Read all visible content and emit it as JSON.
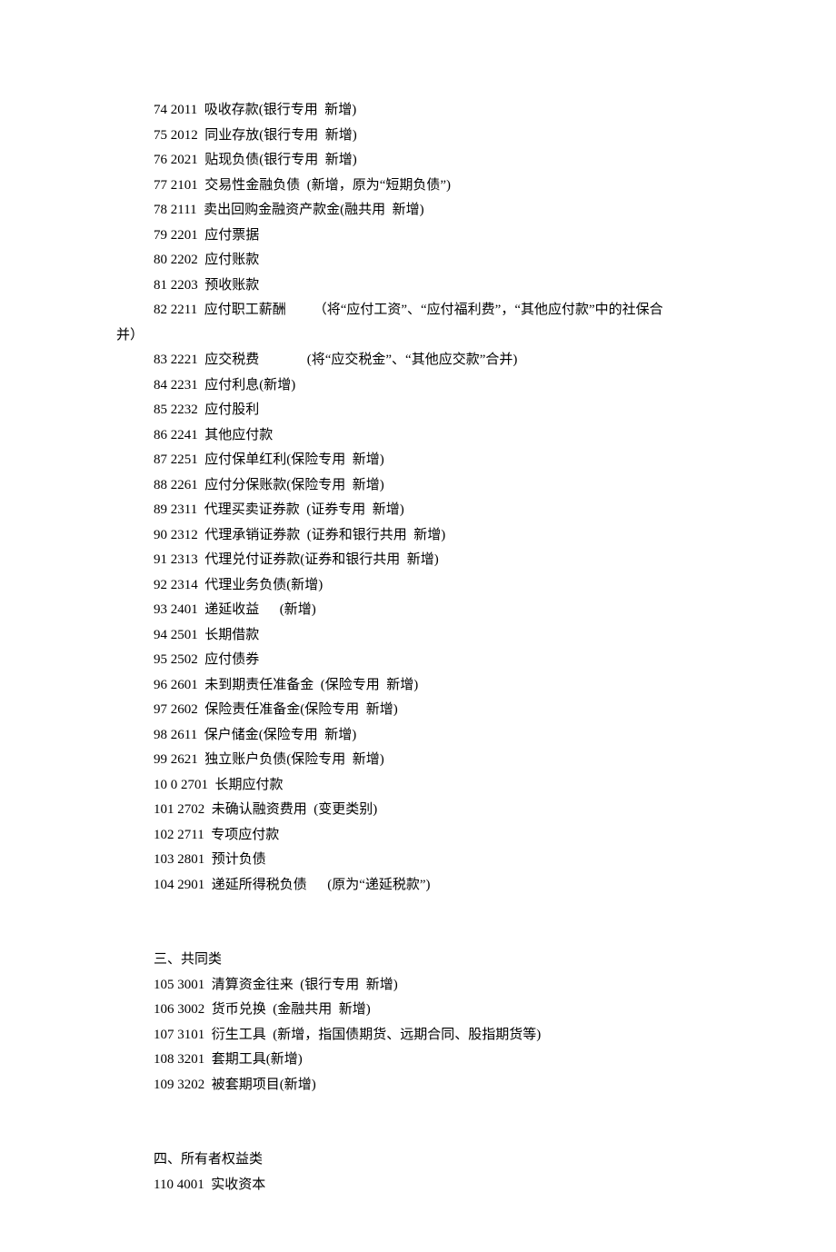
{
  "lines": [
    {
      "cls": "indent",
      "text": "74 2011  吸收存款(银行专用  新增)"
    },
    {
      "cls": "indent",
      "text": "75 2012  同业存放(银行专用  新增)"
    },
    {
      "cls": "indent",
      "text": "76 2021  贴现负债(银行专用  新增)"
    },
    {
      "cls": "indent",
      "text": "77 2101  交易性金融负债  (新增，原为“短期负债”)"
    },
    {
      "cls": "indent",
      "text": "78 2111  卖出回购金融资产款金(融共用  新增)"
    },
    {
      "cls": "indent",
      "text": "79 2201  应付票据"
    },
    {
      "cls": "indent",
      "text": "80 2202  应付账款"
    },
    {
      "cls": "indent",
      "text": "81 2203  预收账款"
    },
    {
      "cls": "indent",
      "text": "82 2211  应付职工薪酬        （将“应付工资”、“应付福利费”，“其他应付款”中的社保合"
    },
    {
      "cls": "no-indent",
      "text": "并）"
    },
    {
      "cls": "indent",
      "text": "83 2221  应交税费              (将“应交税金”、“其他应交款”合并)"
    },
    {
      "cls": "indent",
      "text": "84 2231  应付利息(新增)"
    },
    {
      "cls": "indent",
      "text": "85 2232  应付股利"
    },
    {
      "cls": "indent",
      "text": "86 2241  其他应付款"
    },
    {
      "cls": "indent",
      "text": "87 2251  应付保单红利(保险专用  新增)"
    },
    {
      "cls": "indent",
      "text": "88 2261  应付分保账款(保险专用  新增)"
    },
    {
      "cls": "indent",
      "text": "89 2311  代理买卖证券款  (证券专用  新增)"
    },
    {
      "cls": "indent",
      "text": "90 2312  代理承销证券款  (证券和银行共用  新增)"
    },
    {
      "cls": "indent",
      "text": "91 2313  代理兑付证券款(证券和银行共用  新增)"
    },
    {
      "cls": "indent",
      "text": "92 2314  代理业务负债(新增)"
    },
    {
      "cls": "indent",
      "text": "93 2401  递延收益      (新增)"
    },
    {
      "cls": "indent",
      "text": "94 2501  长期借款"
    },
    {
      "cls": "indent",
      "text": "95 2502  应付债券"
    },
    {
      "cls": "indent",
      "text": "96 2601  未到期责任准备金  (保险专用  新增)"
    },
    {
      "cls": "indent",
      "text": "97 2602  保险责任准备金(保险专用  新增)"
    },
    {
      "cls": "indent",
      "text": "98 2611  保户储金(保险专用  新增)"
    },
    {
      "cls": "indent",
      "text": "99 2621  独立账户负债(保险专用  新增)"
    },
    {
      "cls": "indent",
      "text": "10 0 2701  长期应付款"
    },
    {
      "cls": "indent",
      "text": "101 2702  未确认融资费用  (变更类别)"
    },
    {
      "cls": "indent",
      "text": "102 2711  专项应付款"
    },
    {
      "cls": "indent",
      "text": "103 2801  预计负债"
    },
    {
      "cls": "indent",
      "text": "104 2901  递延所得税负债      (原为“递延税款”)"
    },
    {
      "cls": "blank",
      "text": ""
    },
    {
      "cls": "blank",
      "text": ""
    },
    {
      "cls": "indent",
      "text": "三、共同类"
    },
    {
      "cls": "indent",
      "text": "105 3001  清算资金往来  (银行专用  新增)"
    },
    {
      "cls": "indent",
      "text": "106 3002  货币兑换  (金融共用  新增)"
    },
    {
      "cls": "indent",
      "text": "107 3101  衍生工具  (新增，指国债期货、远期合同、股指期货等)"
    },
    {
      "cls": "indent",
      "text": "108 3201  套期工具(新增)"
    },
    {
      "cls": "indent",
      "text": "109 3202  被套期项目(新增)"
    },
    {
      "cls": "blank",
      "text": ""
    },
    {
      "cls": "blank",
      "text": ""
    },
    {
      "cls": "indent",
      "text": "四、所有者权益类"
    },
    {
      "cls": "indent",
      "text": "110 4001  实收资本"
    }
  ]
}
